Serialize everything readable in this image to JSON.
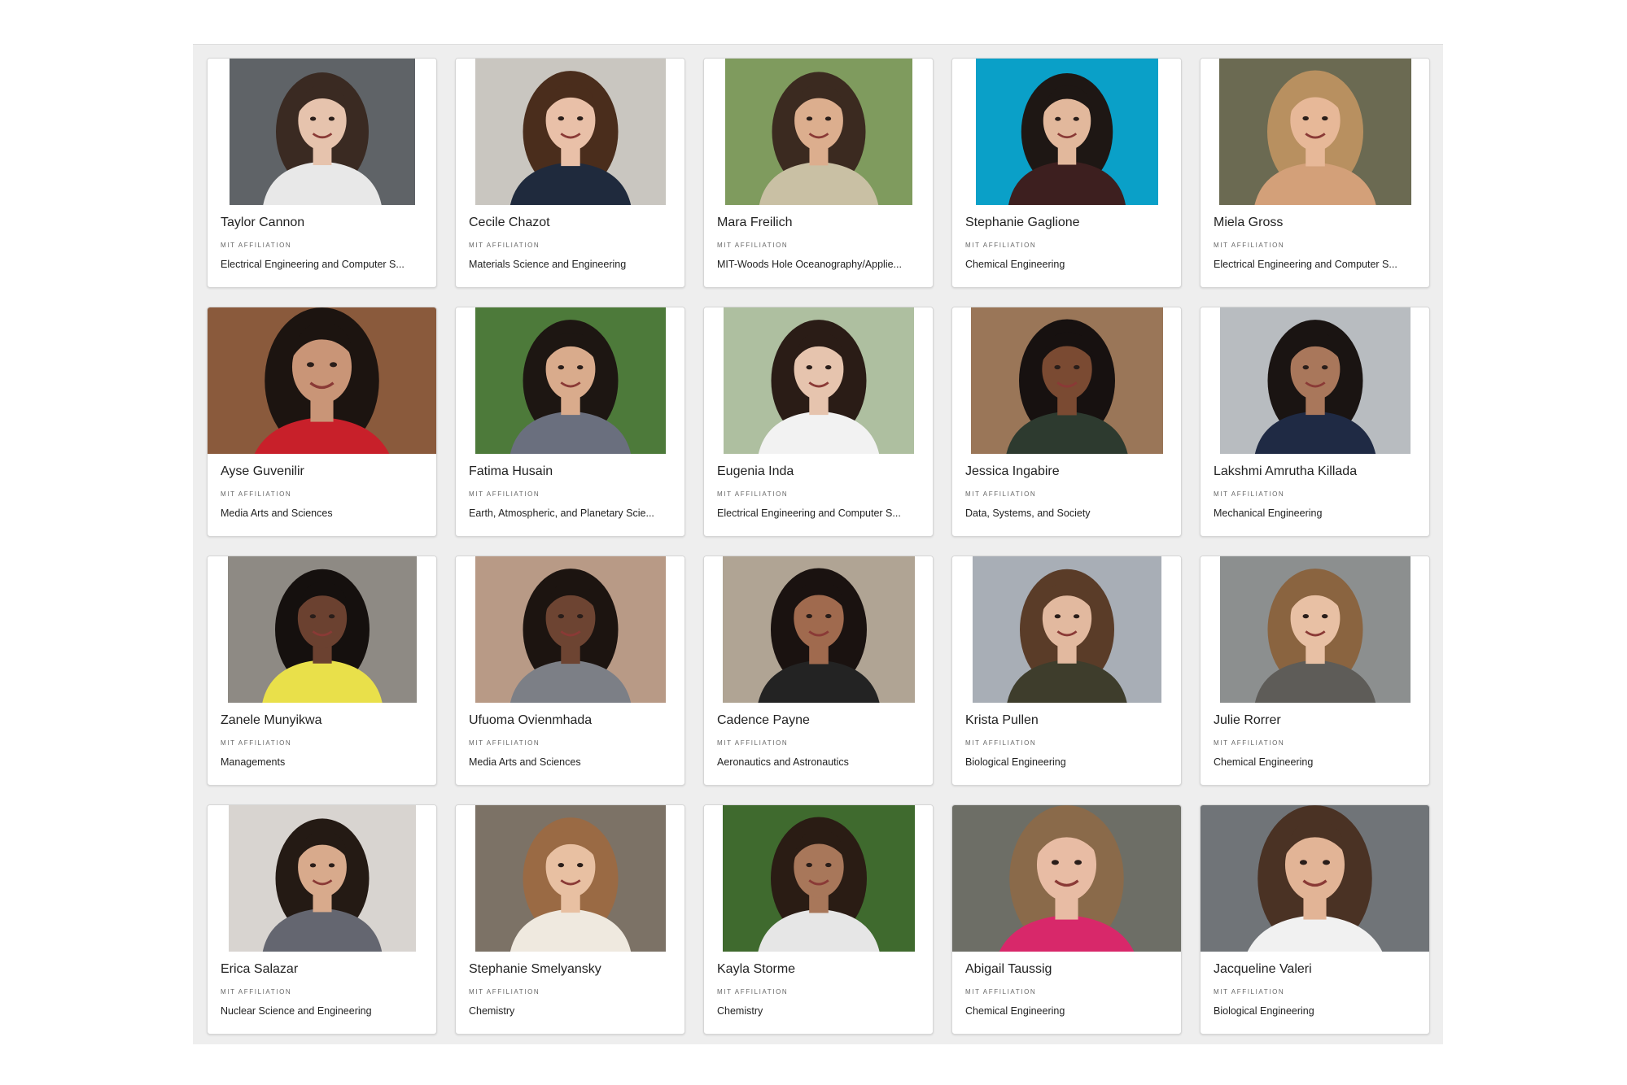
{
  "affiliation_label": "MIT AFFILIATION",
  "people": [
    {
      "name": "Taylor Cannon",
      "department": "Electrical Engineering and Computer S...",
      "bg": "#5f6367",
      "hair": "#3a2a22",
      "skin": "#e6c3ad",
      "shirt": "#e8e8e8",
      "photo_width": 228
    },
    {
      "name": "Cecile Chazot",
      "department": "Materials Science and Engineering",
      "bg": "#c9c6c0",
      "hair": "#4a2d1c",
      "skin": "#e9c0a8",
      "shirt": "#1f2a3d",
      "photo_width": 234
    },
    {
      "name": "Mara Freilich",
      "department": "MIT-Woods Hole Oceanography/Applie...",
      "bg": "#7f9b5e",
      "hair": "#3b2a20",
      "skin": "#dcae8e",
      "shirt": "#c9c0a4",
      "photo_width": 230
    },
    {
      "name": "Stephanie Gaglione",
      "department": "Chemical Engineering",
      "bg": "#0aa0c8",
      "hair": "#1e1714",
      "skin": "#e2b89c",
      "shirt": "#3d1f1f",
      "photo_width": 224
    },
    {
      "name": "Miela Gross",
      "department": "Electrical Engineering and Computer S...",
      "bg": "#6b6a52",
      "hair": "#b89060",
      "skin": "#e7b898",
      "shirt": "#d3a079",
      "photo_width": 236
    },
    {
      "name": "Ayse Guvenilir",
      "department": "Media Arts and Sciences",
      "bg": "#8a5a3c",
      "hair": "#1c1410",
      "skin": "#c99577",
      "shirt": "#c8202a",
      "photo_width": 283
    },
    {
      "name": "Fatima Husain",
      "department": "Earth, Atmospheric, and Planetary Scie...",
      "bg": "#4d7a3a",
      "hair": "#1d1612",
      "skin": "#d9ab8c",
      "shirt": "#6a6f7e",
      "photo_width": 234
    },
    {
      "name": "Eugenia Inda",
      "department": "Electrical Engineering and Computer S...",
      "bg": "#aebfa0",
      "hair": "#2a1c16",
      "skin": "#e6c4ae",
      "shirt": "#f2f2f2",
      "photo_width": 234
    },
    {
      "name": "Jessica Ingabire",
      "department": "Data, Systems, and Society",
      "bg": "#9a7658",
      "hair": "#171110",
      "skin": "#7a4a32",
      "shirt": "#2d3a2f",
      "photo_width": 236
    },
    {
      "name": "Lakshmi Amrutha Killada",
      "department": "Mechanical Engineering",
      "bg": "#b8bcc0",
      "hair": "#1a1412",
      "skin": "#a9775b",
      "shirt": "#1f2a44",
      "photo_width": 234
    },
    {
      "name": "Zanele Munyikwa",
      "department": "Managements",
      "bg": "#8e8a84",
      "hair": "#15100e",
      "skin": "#6b4130",
      "shirt": "#e9e04a",
      "photo_width": 232
    },
    {
      "name": "Ufuoma Ovienmhada",
      "department": "Media Arts and Sciences",
      "bg": "#b89a86",
      "hair": "#1c1410",
      "skin": "#6d4432",
      "shirt": "#7c7f86",
      "photo_width": 234
    },
    {
      "name": "Cadence Payne",
      "department": "Aeronautics and Astronautics",
      "bg": "#b0a494",
      "hair": "#1a1210",
      "skin": "#a06a4e",
      "shirt": "#232323",
      "photo_width": 236
    },
    {
      "name": "Krista Pullen",
      "department": "Biological Engineering",
      "bg": "#a8aeb6",
      "hair": "#5a3c28",
      "skin": "#e2b99f",
      "shirt": "#3e3d2c",
      "photo_width": 232
    },
    {
      "name": "Julie Rorrer",
      "department": "Chemical Engineering",
      "bg": "#8c8f8f",
      "hair": "#8a6440",
      "skin": "#e8c0a4",
      "shirt": "#5e5c58",
      "photo_width": 234
    },
    {
      "name": "Erica Salazar",
      "department": "Nuclear Science and Engineering",
      "bg": "#d8d4d0",
      "hair": "#241a14",
      "skin": "#d8aa8c",
      "shirt": "#646670",
      "photo_width": 230
    },
    {
      "name": "Stephanie Smelyansky",
      "department": "Chemistry",
      "bg": "#7c7266",
      "hair": "#9a6a44",
      "skin": "#e8c0a2",
      "shirt": "#efe9df",
      "photo_width": 234
    },
    {
      "name": "Kayla Storme",
      "department": "Chemistry",
      "bg": "#3f6a2e",
      "hair": "#2a1c14",
      "skin": "#a8775a",
      "shirt": "#e6e6e6",
      "photo_width": 236
    },
    {
      "name": "Abigail Taussig",
      "department": "Chemical Engineering",
      "bg": "#6d6e66",
      "hair": "#8a6a4a",
      "skin": "#e8bca4",
      "shirt": "#d8286a",
      "photo_width": 283
    },
    {
      "name": "Jacqueline Valeri",
      "department": "Biological Engineering",
      "bg": "#707478",
      "hair": "#4a3224",
      "skin": "#e2b496",
      "shirt": "#f1f1f1",
      "photo_width": 283
    }
  ]
}
